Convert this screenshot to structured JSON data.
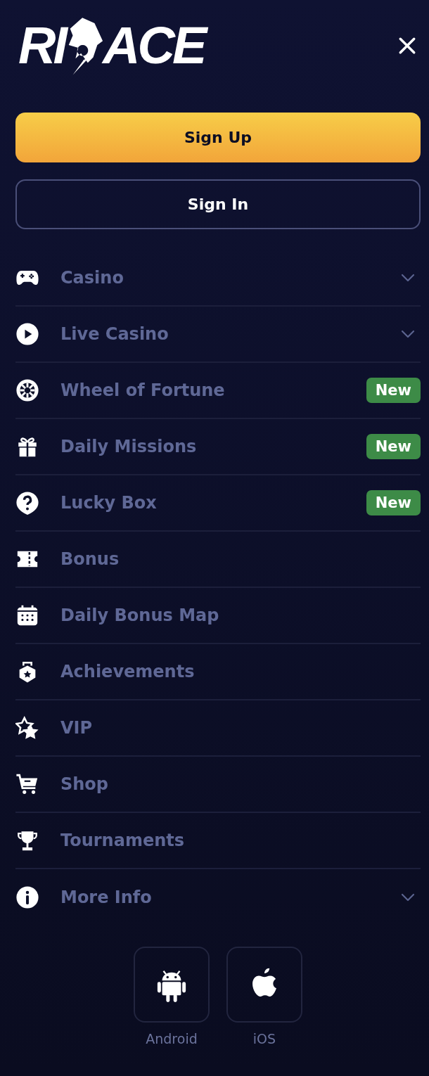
{
  "logo": {
    "left": "RI",
    "right": "ACE"
  },
  "buttons": [
    {
      "label": "Sign Up",
      "kind": "primary"
    },
    {
      "label": "Sign In",
      "kind": "outline"
    }
  ],
  "menu": [
    {
      "label": "Casino",
      "has_submenu": true
    },
    {
      "label": "Live Casino",
      "has_submenu": true
    },
    {
      "label": "Wheel of Fortune",
      "has_submenu": false,
      "badge": "New"
    },
    {
      "label": "Daily Missions",
      "has_submenu": false,
      "badge": "New"
    },
    {
      "label": "Lucky Box",
      "has_submenu": false,
      "badge": "New"
    },
    {
      "label": "Bonus",
      "has_submenu": false
    },
    {
      "label": "Daily Bonus Map",
      "has_submenu": false
    },
    {
      "label": "Achievements",
      "has_submenu": false
    },
    {
      "label": "VIP",
      "has_submenu": false
    },
    {
      "label": "Shop",
      "has_submenu": false
    },
    {
      "label": "Tournaments",
      "has_submenu": false
    },
    {
      "label": "More Info",
      "has_submenu": true
    }
  ],
  "apps": [
    {
      "label": "Android",
      "kind": "android"
    },
    {
      "label": "iOS",
      "kind": "ios"
    }
  ]
}
